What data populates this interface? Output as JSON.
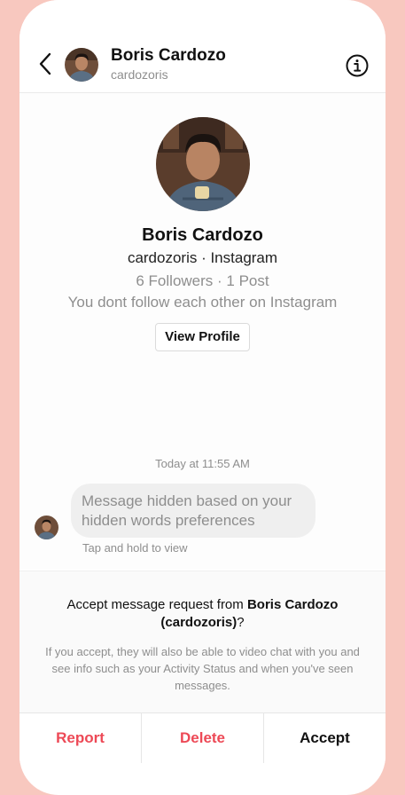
{
  "header": {
    "name": "Boris Cardozo",
    "username": "cardozoris"
  },
  "profile": {
    "name": "Boris Cardozo",
    "subtitle": "cardozoris · Instagram",
    "stats": "6 Followers · 1 Post",
    "follow_status": "You dont follow each other on Instagram",
    "view_profile_label": "View Profile"
  },
  "thread": {
    "timestamp": "Today at 11:55 AM",
    "message": "Message hidden based on your hidden words preferences",
    "tap_hint": "Tap and hold to view"
  },
  "request": {
    "prompt_prefix": "Accept message request from",
    "requester_name": "Boris Cardozo",
    "requester_handle": "(cardozoris)",
    "prompt_suffix": "?",
    "note": "If you accept, they will also be able to video chat with you and see info such as your Activity Status and when you've seen messages."
  },
  "actions": {
    "report": "Report",
    "delete": "Delete",
    "accept": "Accept"
  },
  "colors": {
    "background": "#f8c8bf",
    "danger": "#ed4956",
    "muted": "#8e8e8e"
  },
  "icons": {
    "back": "chevron-left-icon",
    "info": "info-circle-icon"
  }
}
